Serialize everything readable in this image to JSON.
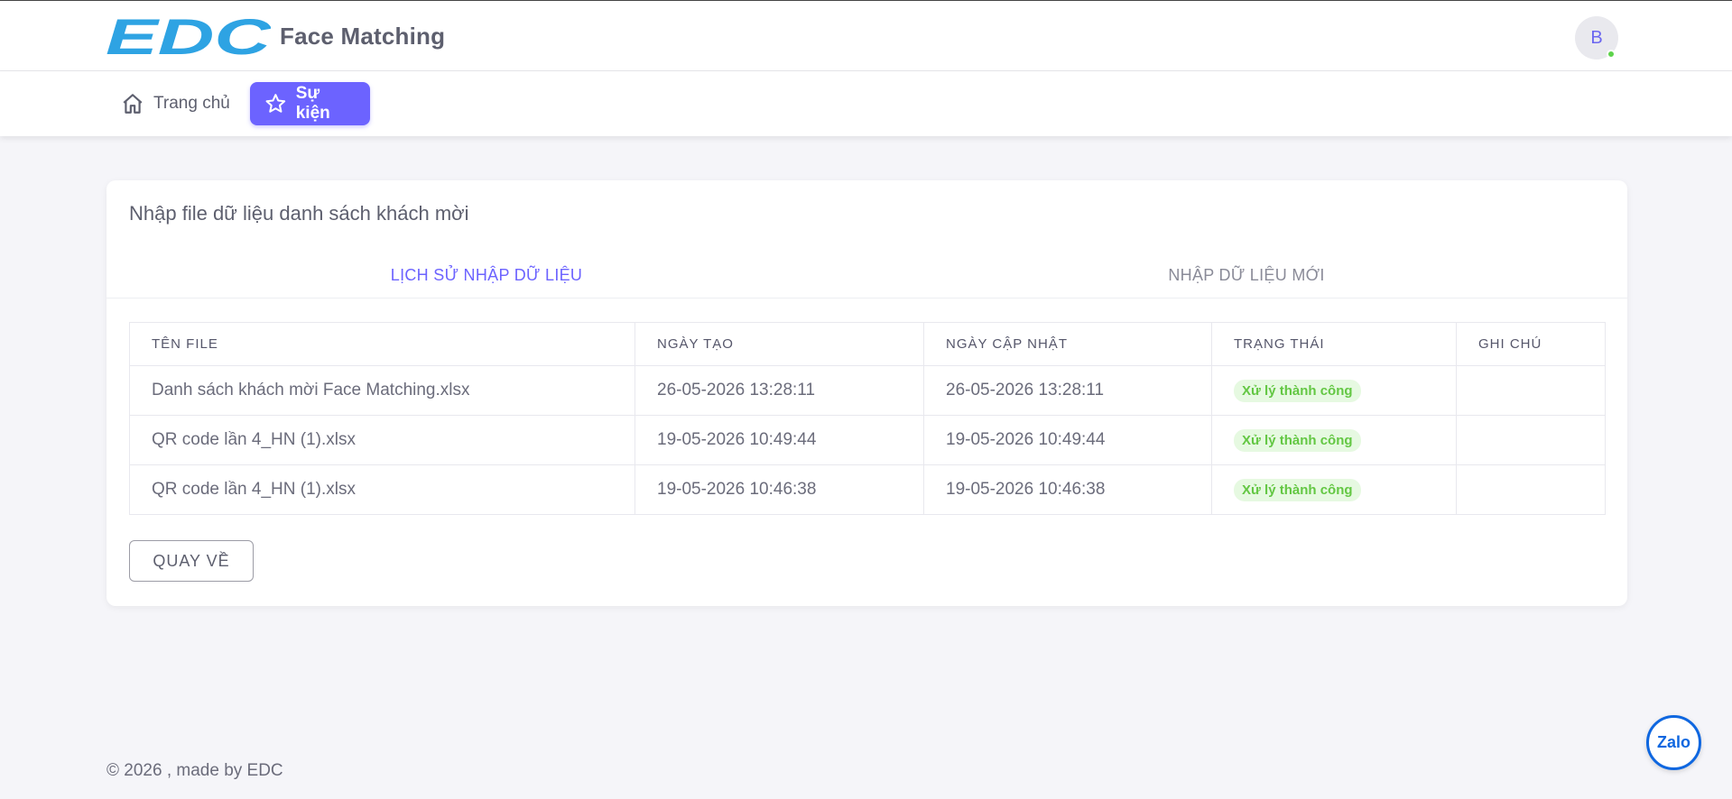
{
  "header": {
    "logo_text": "EDC",
    "app_title": "Face Matching",
    "avatar_initial": "B"
  },
  "nav": {
    "home_label": "Trang chủ",
    "events_label": "Sự kiện"
  },
  "card": {
    "title": "Nhập file dữ liệu danh sách khách mời",
    "tabs": [
      {
        "label": "LỊCH SỬ NHẬP DỮ LIỆU",
        "active": true
      },
      {
        "label": "NHẬP DỮ LIỆU MỚI",
        "active": false
      }
    ],
    "table": {
      "headers": [
        "TÊN FILE",
        "NGÀY TẠO",
        "NGÀY CẬP NHẬT",
        "TRẠNG THÁI",
        "GHI CHÚ"
      ],
      "rows": [
        {
          "file": "Danh sách khách mời Face Matching.xlsx",
          "created": "26-05-2026 13:28:11",
          "updated": "26-05-2026 13:28:11",
          "status": "Xử lý thành công",
          "note": ""
        },
        {
          "file": "QR code lần 4_HN (1).xlsx",
          "created": "19-05-2026 10:49:44",
          "updated": "19-05-2026 10:49:44",
          "status": "Xử lý thành công",
          "note": ""
        },
        {
          "file": "QR code lần 4_HN (1).xlsx",
          "created": "19-05-2026 10:46:38",
          "updated": "19-05-2026 10:46:38",
          "status": "Xử lý thành công",
          "note": ""
        }
      ]
    },
    "back_button_label": "QUAY VỀ"
  },
  "footer": {
    "text": "© 2026 , made by EDC"
  },
  "widget": {
    "zalo_label": "Zalo"
  },
  "colors": {
    "accent": "#6c63ff",
    "logo_blue": "#2ea3e3",
    "status_success_bg": "#e6f9e1",
    "status_success_text": "#63c743"
  },
  "icons": {
    "home": "home-icon",
    "events": "star-icon",
    "zalo": "zalo-icon"
  }
}
